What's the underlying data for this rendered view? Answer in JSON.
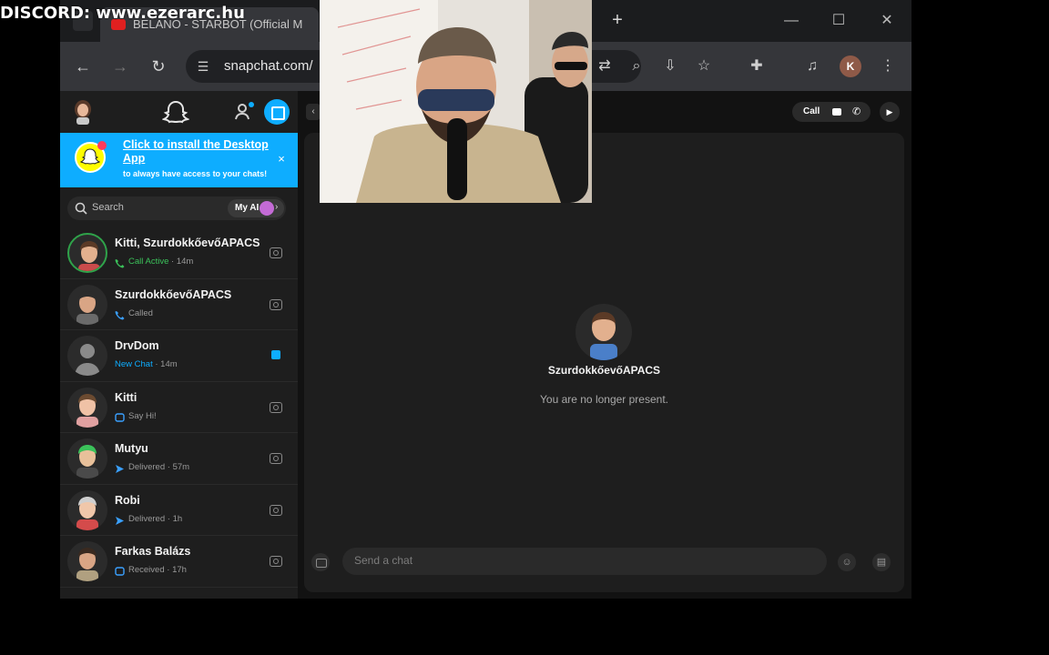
{
  "overlay": {
    "discord_text": "DISCORD: www.ezerarc.hu"
  },
  "browser": {
    "tab_title": "BELANO - STARBOT (Official M",
    "url": "snapchat.com/",
    "profile_initial": "K",
    "new_tab_symbol": "+",
    "controls": {
      "minimize": "—",
      "maximize": "☐",
      "close": "✕"
    }
  },
  "banner": {
    "title": "Click to install the Desktop App",
    "subtitle": "to always have access to your chats!",
    "close": "×"
  },
  "search": {
    "placeholder": "Search",
    "my_ai_label": "My AI"
  },
  "chats": [
    {
      "name": "Kitti, SzurdokkőevőAPACS",
      "status": "Call Active",
      "time": "14m",
      "status_color": "#3bc25a",
      "status_icon": "phone-icon",
      "trailing": "camera-icon"
    },
    {
      "name": "SzurdokkőevőAPACS",
      "status": "Called",
      "time": "",
      "status_color": "#9a9a9a",
      "status_icon": "phone-outgoing-icon",
      "trailing": "camera-icon"
    },
    {
      "name": "DrvDom",
      "status": "New Chat",
      "time": "14m",
      "status_color": "#0eadff",
      "status_icon": "",
      "trailing": "chat-bubble-icon"
    },
    {
      "name": "Kitti",
      "status": "Say Hi!",
      "time": "",
      "status_color": "#9a9a9a",
      "status_icon": "chat-outline-icon",
      "trailing": "camera-icon"
    },
    {
      "name": "Mutyu",
      "status": "Delivered",
      "time": "57m",
      "status_color": "#9a9a9a",
      "status_icon": "arrow-icon",
      "trailing": "camera-icon"
    },
    {
      "name": "Robi",
      "status": "Delivered",
      "time": "1h",
      "status_color": "#9a9a9a",
      "status_icon": "arrow-icon",
      "trailing": "camera-icon"
    },
    {
      "name": "Farkas Balázs",
      "status": "Received",
      "time": "17h",
      "status_color": "#9a9a9a",
      "status_icon": "chat-outline-icon",
      "trailing": "camera-icon"
    }
  ],
  "conversation": {
    "call_label": "Call",
    "friend_name": "SzurdokkőevőAPACS",
    "presence_text": "You are no longer present.",
    "input_placeholder": "Send a chat"
  },
  "colors": {
    "snap_blue": "#0eadff",
    "snap_yellow": "#fffc00",
    "call_green": "#3bc25a"
  }
}
